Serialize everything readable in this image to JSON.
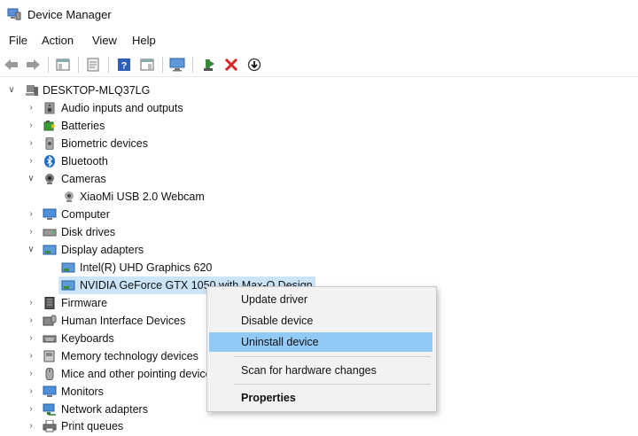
{
  "window": {
    "title": "Device Manager"
  },
  "menu": [
    "File",
    "Action",
    "View",
    "Help"
  ],
  "tree": {
    "root": "DESKTOP-MLQ37LG",
    "categories": [
      "Audio inputs and outputs",
      "Batteries",
      "Biometric devices",
      "Bluetooth",
      "Cameras",
      "XiaoMi USB 2.0 Webcam",
      "Computer",
      "Disk drives",
      "Display adapters",
      "Intel(R) UHD Graphics 620",
      "NVIDIA GeForce GTX 1050 with Max-Q Design",
      "Firmware",
      "Human Interface Devices",
      "Keyboards",
      "Memory technology devices",
      "Mice and other pointing devices",
      "Monitors",
      "Network adapters",
      "Print queues"
    ]
  },
  "context_menu": {
    "items": [
      "Update driver",
      "Disable device",
      "Uninstall device",
      "Scan for hardware changes",
      "Properties"
    ],
    "highlighted": "Uninstall device"
  },
  "colors": {
    "selection": "#cce4f7",
    "menu_highlight": "#91c9f7",
    "delete_red": "#d9262b"
  }
}
